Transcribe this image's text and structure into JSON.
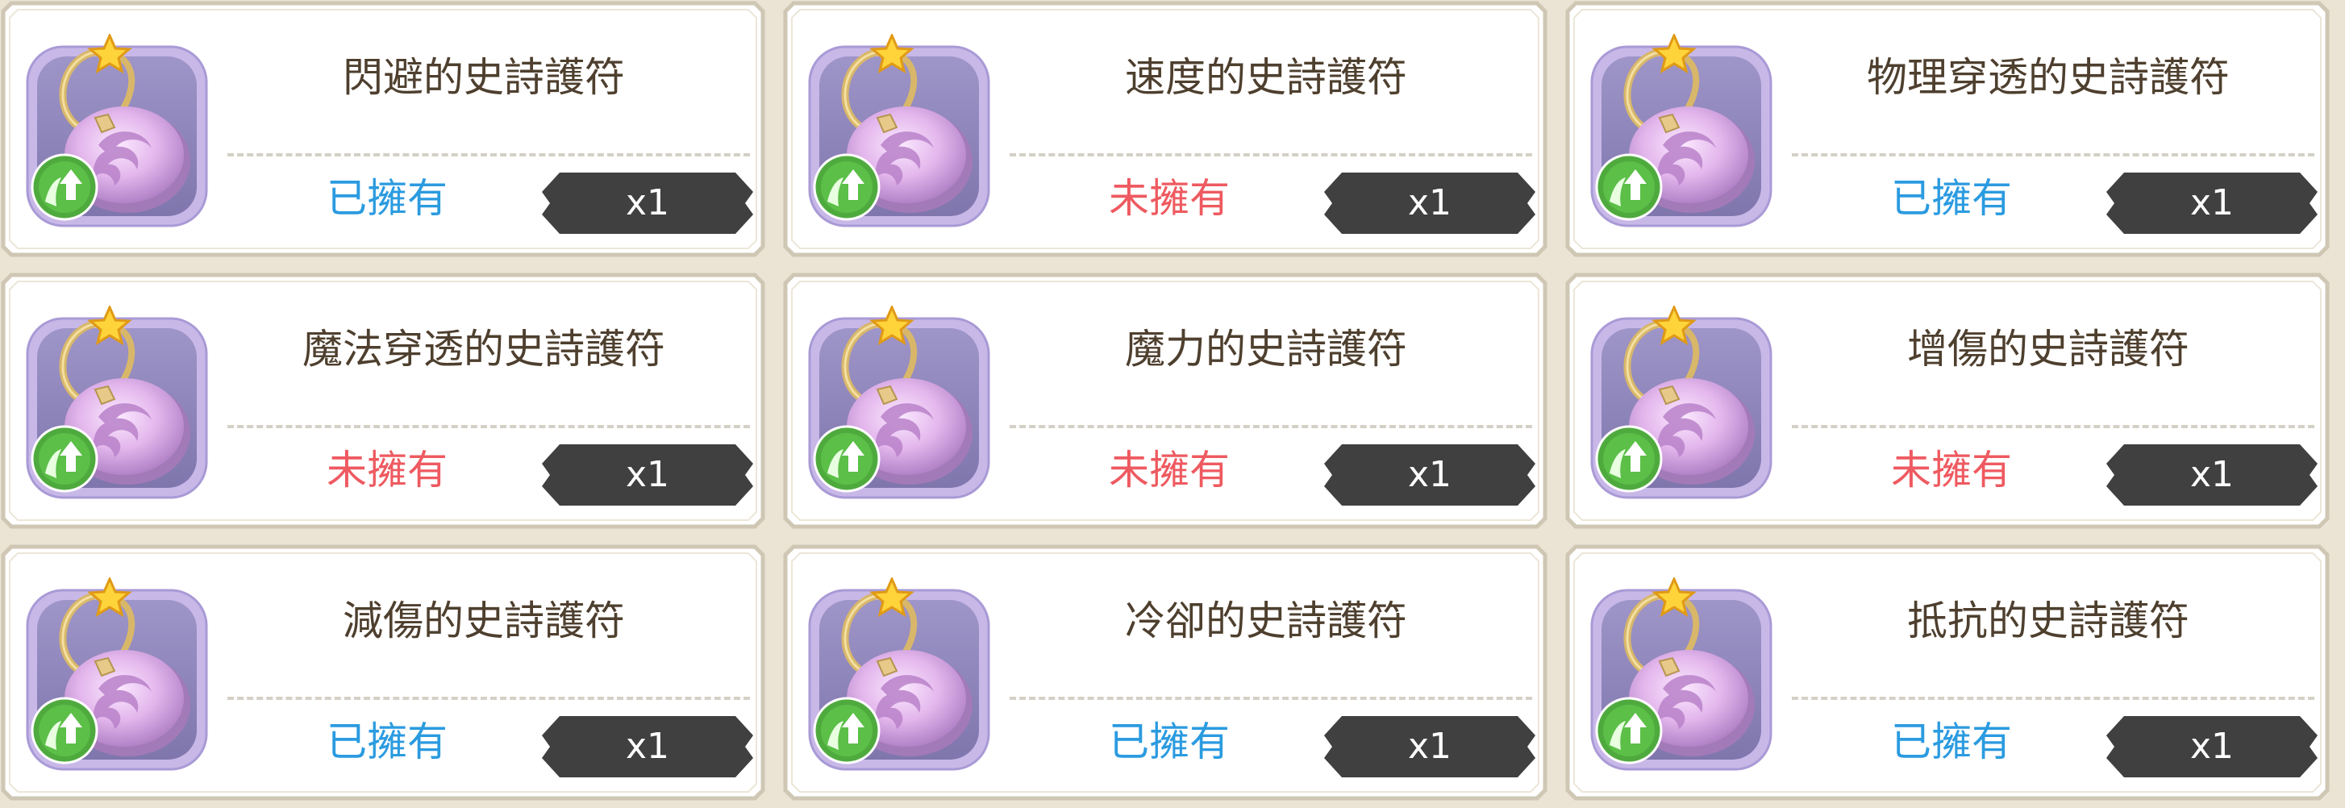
{
  "colors": {
    "owned": "#2b9be0",
    "not_owned": "#ee5a60",
    "name_text": "#4e3f2e",
    "qty_badge": "#404040",
    "card_fill": "#ffffff",
    "card_border": "#cfc7b4"
  },
  "items": [
    {
      "name": "閃避的史詩護符",
      "status": "已擁有",
      "owned": true,
      "quantity": "x1",
      "stat_icon": "evasion-up-icon"
    },
    {
      "name": "速度的史詩護符",
      "status": "未擁有",
      "owned": false,
      "quantity": "x1",
      "stat_icon": "speed-up-icon"
    },
    {
      "name": "物理穿透的史詩護符",
      "status": "已擁有",
      "owned": true,
      "quantity": "x1",
      "stat_icon": "physical-penetration-up-icon"
    },
    {
      "name": "魔法穿透的史詩護符",
      "status": "未擁有",
      "owned": false,
      "quantity": "x1",
      "stat_icon": "magic-penetration-up-icon"
    },
    {
      "name": "魔力的史詩護符",
      "status": "未擁有",
      "owned": false,
      "quantity": "x1",
      "stat_icon": "magic-power-up-icon"
    },
    {
      "name": "增傷的史詩護符",
      "status": "未擁有",
      "owned": false,
      "quantity": "x1",
      "stat_icon": "damage-boost-up-icon"
    },
    {
      "name": "減傷的史詩護符",
      "status": "已擁有",
      "owned": true,
      "quantity": "x1",
      "stat_icon": "damage-reduction-up-icon"
    },
    {
      "name": "冷卻的史詩護符",
      "status": "已擁有",
      "owned": true,
      "quantity": "x1",
      "stat_icon": "cooldown-down-icon"
    },
    {
      "name": "抵抗的史詩護符",
      "status": "已擁有",
      "owned": true,
      "quantity": "x1",
      "stat_icon": "resistance-up-icon"
    }
  ]
}
